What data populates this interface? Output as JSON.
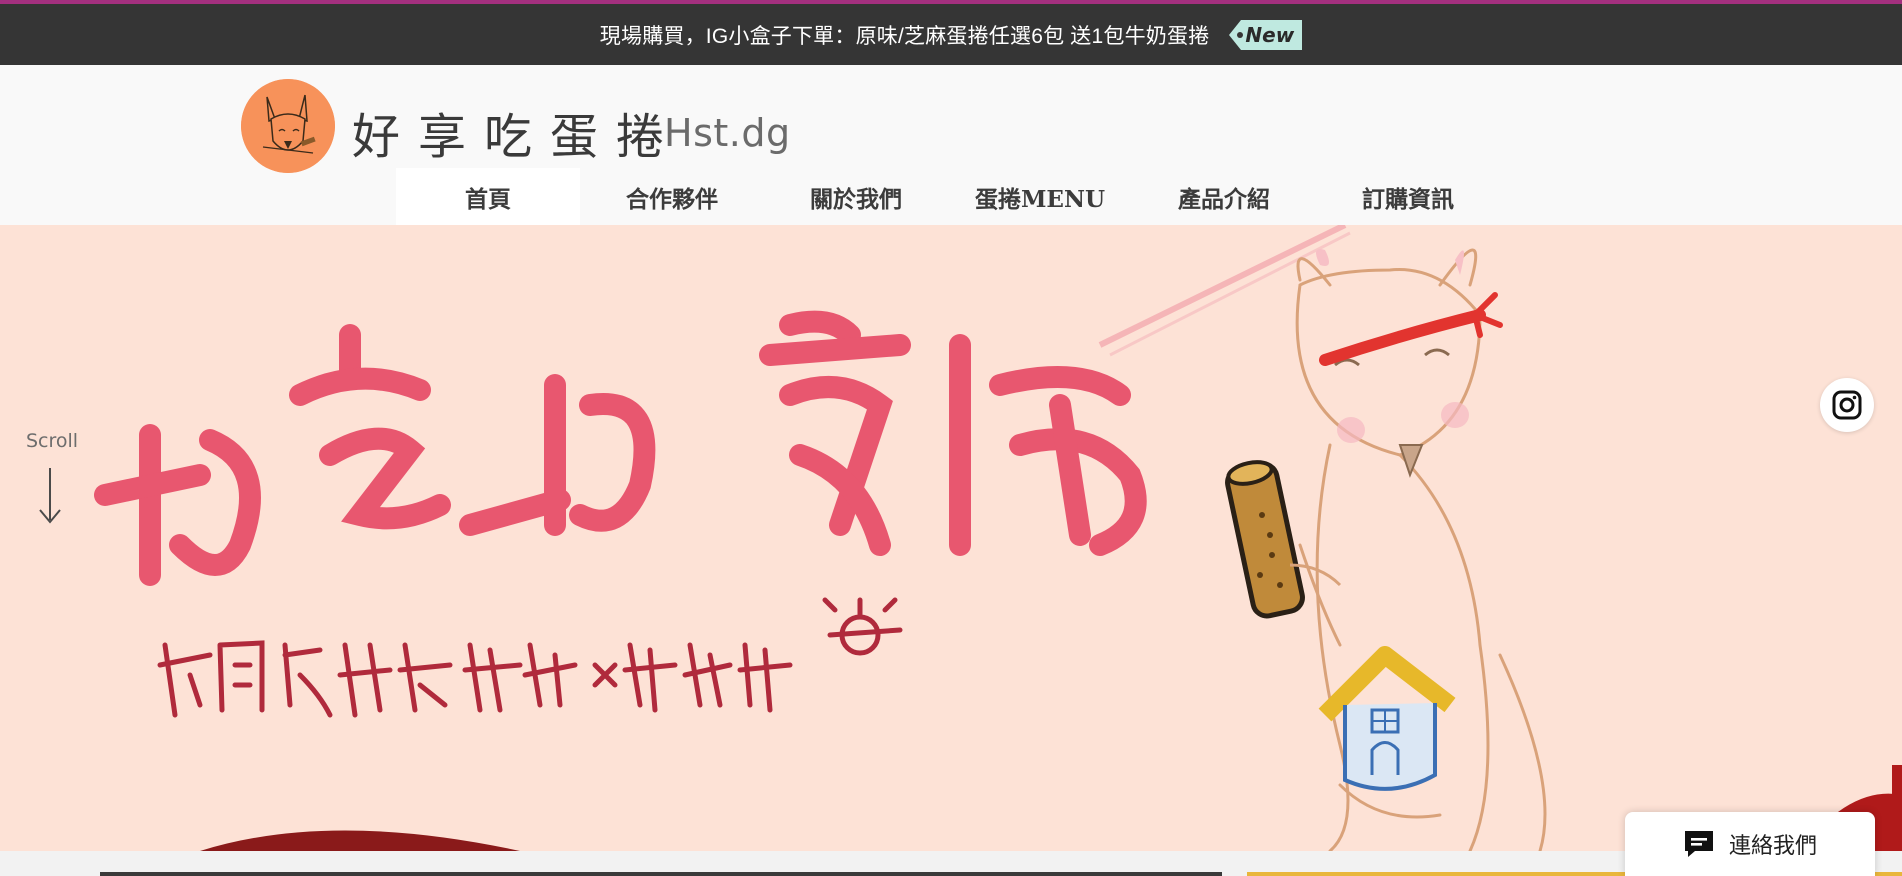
{
  "announcement": {
    "text": "現場購買，IG小盒子下單：原味/芝麻蛋捲任選6包 送1包牛奶蛋捲",
    "badge": "New"
  },
  "header": {
    "title": "好享吃蛋捲",
    "subtitle": "Hst.dg"
  },
  "nav": {
    "items": [
      {
        "label": "首頁",
        "active": true
      },
      {
        "label": "合作夥伴"
      },
      {
        "label": "關於我們"
      },
      {
        "label": "蛋捲MENU"
      },
      {
        "label": "產品介紹"
      },
      {
        "label": "訂購資訊"
      }
    ]
  },
  "hero": {
    "scroll_label": "Scroll"
  },
  "chat": {
    "label": "連絡我們"
  },
  "colors": {
    "accent_line": "#a4307f",
    "announce_bg": "#353535",
    "hero_bg": "#fde2d6",
    "lettering": "#e8576f"
  }
}
